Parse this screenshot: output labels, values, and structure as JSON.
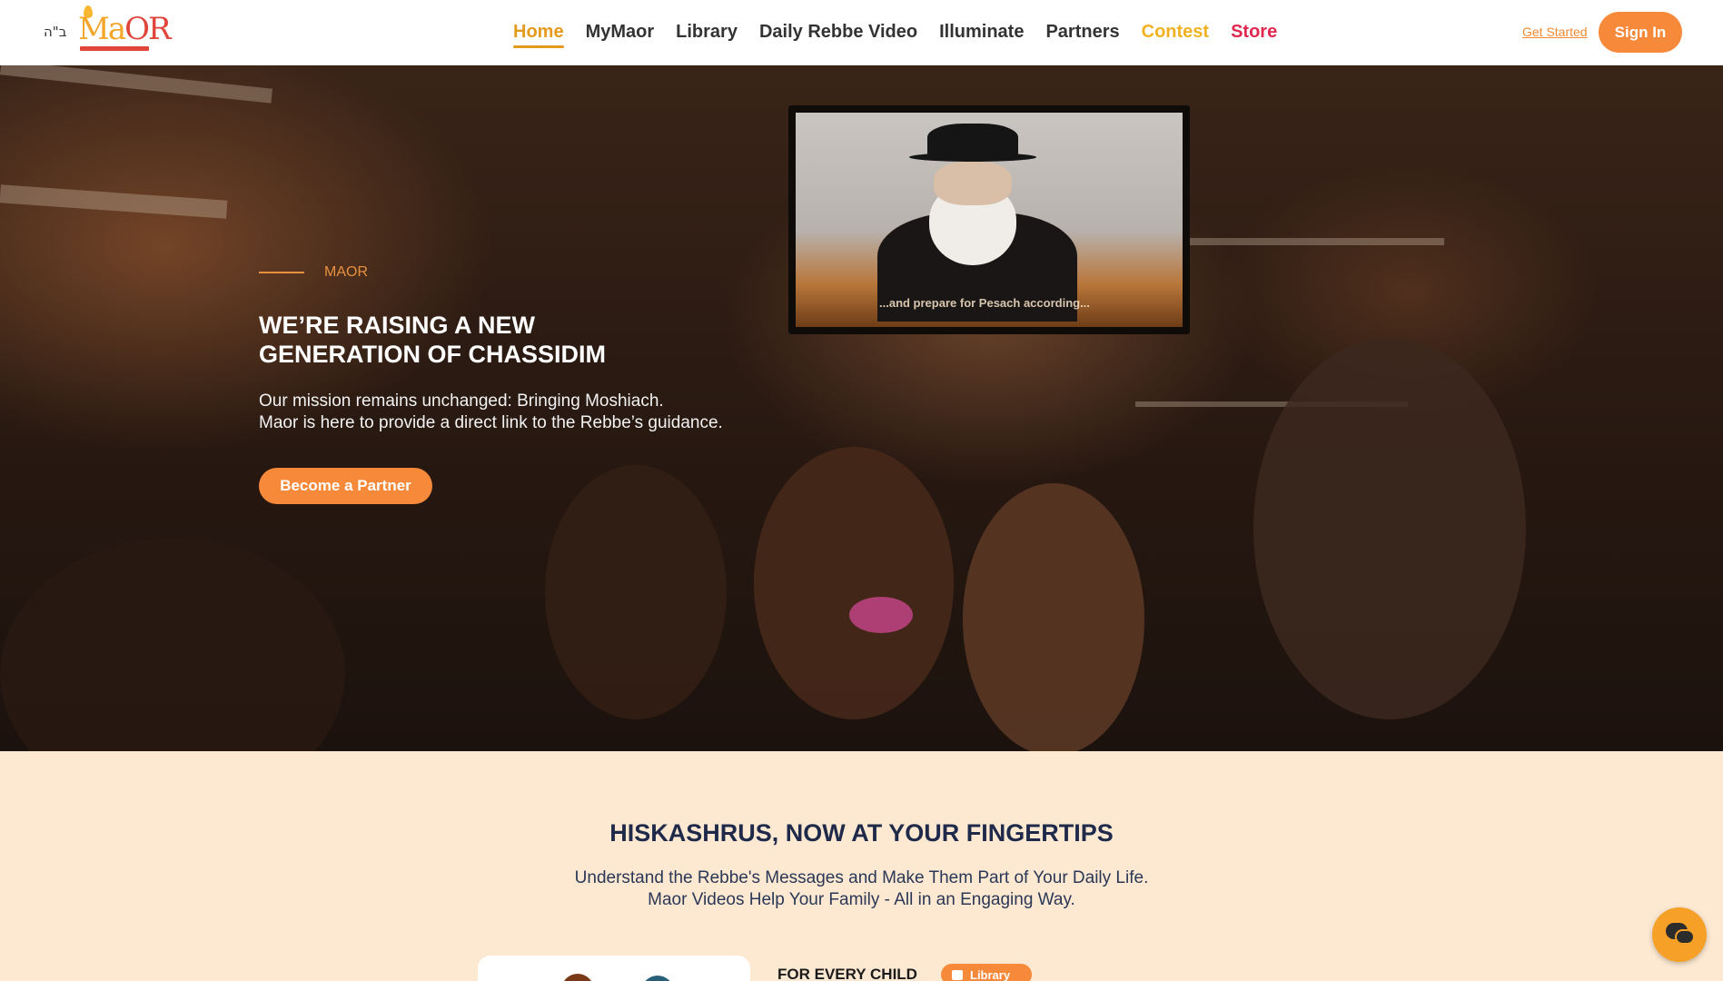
{
  "header": {
    "bh": "ב\"ה",
    "logo": {
      "word_primary": "Ma",
      "word_accent": "OR"
    },
    "nav": [
      {
        "label": "Home",
        "active": true
      },
      {
        "label": "MyMaor"
      },
      {
        "label": "Library"
      },
      {
        "label": "Daily Rebbe Video"
      },
      {
        "label": "Illuminate"
      },
      {
        "label": "Partners"
      },
      {
        "label": "Contest"
      },
      {
        "label": "Store"
      }
    ],
    "get_started": "Get Started",
    "sign_in": "Sign In"
  },
  "hero": {
    "eyebrow": "MAOR",
    "title": "WE’RE RAISING A NEW GENERATION OF CHASSIDIM",
    "description_line1": "Our mission remains unchanged: Bringing Moshiach.",
    "description_line2": "Maor is here to provide a direct link to the Rebbe’s guidance.",
    "cta": "Become a Partner",
    "tv_caption": "...and prepare for Pesach according..."
  },
  "section": {
    "title": "HISKASHRUS, NOW AT YOUR FINGERTIPS",
    "subtitle_line1": "Understand the Rebbe's Messages and Make Them Part of Your Daily Life.",
    "subtitle_line2": "Maor Videos Help Your Family - All in an Engaging Way.",
    "feature_heading": "FOR EVERY CHILD",
    "feature_badge": "Library"
  },
  "colors": {
    "accent_orange": "#f7893a",
    "nav_active": "#e49a1c",
    "contest": "#f2b120",
    "store": "#e0284f",
    "section_bg": "#fde9d2",
    "navy": "#1f2a4a"
  },
  "icons": {
    "chat": "chat-bubbles-icon",
    "library_badge": "library-icon"
  }
}
